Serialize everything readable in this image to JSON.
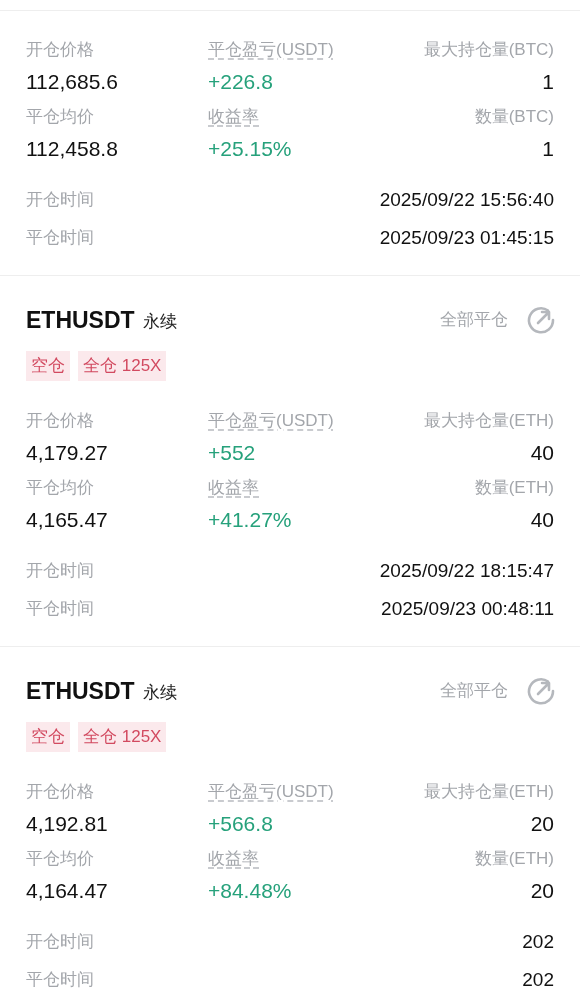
{
  "positions": [
    {
      "stats": [
        {
          "label": "开仓价格",
          "value": "112,685.6",
          "underlined": false,
          "profit": false
        },
        {
          "label": "平仓盈亏(USDT)",
          "value": "+226.8",
          "underlined": true,
          "profit": true
        },
        {
          "label": "最大持仓量(BTC)",
          "value": "1",
          "underlined": false,
          "profit": false
        },
        {
          "label": "平仓均价",
          "value": "112,458.8",
          "underlined": false,
          "profit": false
        },
        {
          "label": "收益率",
          "value": "+25.15%",
          "underlined": true,
          "profit": true
        },
        {
          "label": "数量(BTC)",
          "value": "1",
          "underlined": false,
          "profit": false
        }
      ],
      "times": [
        {
          "label": "开仓时间",
          "value": "2025/09/22 15:56:40"
        },
        {
          "label": "平仓时间",
          "value": "2025/09/23 01:45:15"
        }
      ]
    },
    {
      "header": {
        "symbol": "ETHUSDT",
        "contract": "永续",
        "close_all": "全部平仓"
      },
      "tags": [
        "空仓",
        "全仓 125X"
      ],
      "stats": [
        {
          "label": "开仓价格",
          "value": "4,179.27",
          "underlined": false,
          "profit": false
        },
        {
          "label": "平仓盈亏(USDT)",
          "value": "+552",
          "underlined": true,
          "profit": true
        },
        {
          "label": "最大持仓量(ETH)",
          "value": "40",
          "underlined": false,
          "profit": false
        },
        {
          "label": "平仓均价",
          "value": "4,165.47",
          "underlined": false,
          "profit": false
        },
        {
          "label": "收益率",
          "value": "+41.27%",
          "underlined": true,
          "profit": true
        },
        {
          "label": "数量(ETH)",
          "value": "40",
          "underlined": false,
          "profit": false
        }
      ],
      "times": [
        {
          "label": "开仓时间",
          "value": "2025/09/22 18:15:47"
        },
        {
          "label": "平仓时间",
          "value": "2025/09/23 00:48:11"
        }
      ]
    },
    {
      "header": {
        "symbol": "ETHUSDT",
        "contract": "永续",
        "close_all": "全部平仓"
      },
      "tags": [
        "空仓",
        "全仓 125X"
      ],
      "stats": [
        {
          "label": "开仓价格",
          "value": "4,192.81",
          "underlined": false,
          "profit": false
        },
        {
          "label": "平仓盈亏(USDT)",
          "value": "+566.8",
          "underlined": true,
          "profit": true
        },
        {
          "label": "最大持仓量(ETH)",
          "value": "20",
          "underlined": false,
          "profit": false
        },
        {
          "label": "平仓均价",
          "value": "4,164.47",
          "underlined": false,
          "profit": false
        },
        {
          "label": "收益率",
          "value": "+84.48%",
          "underlined": true,
          "profit": true
        },
        {
          "label": "数量(ETH)",
          "value": "20",
          "underlined": false,
          "profit": false
        }
      ],
      "times": [
        {
          "label": "开仓时间",
          "value": "202"
        },
        {
          "label": "平仓时间",
          "value": "202"
        }
      ]
    }
  ]
}
